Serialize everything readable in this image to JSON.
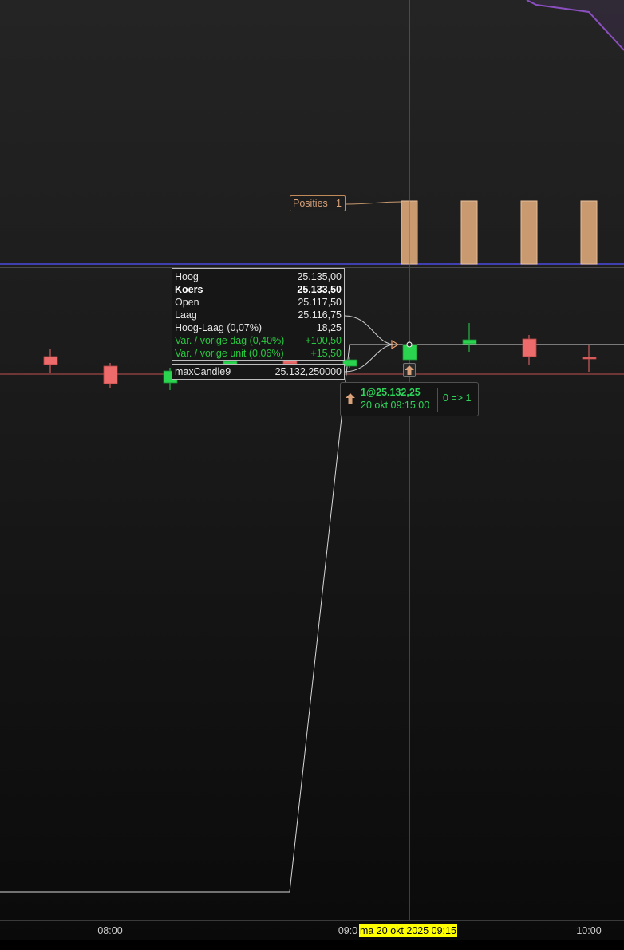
{
  "positions_panel": {
    "label": "Posities",
    "value": "1"
  },
  "tooltip": {
    "rows": [
      {
        "label": "Hoog",
        "value": "25.135,00",
        "style": "normal"
      },
      {
        "label": "Koers",
        "value": "25.133,50",
        "style": "bold"
      },
      {
        "label": "Open",
        "value": "25.117,50",
        "style": "normal"
      },
      {
        "label": "Laag",
        "value": "25.116,75",
        "style": "normal"
      },
      {
        "label": "Hoog-Laag (0,07%)",
        "value": "18,25",
        "style": "normal"
      },
      {
        "label": "Var. / vorige dag (0,40%)",
        "value": "+100,50",
        "style": "green"
      },
      {
        "label": "Var. / vorige unit (0,06%)",
        "value": "+15,50",
        "style": "green"
      }
    ]
  },
  "indicator": {
    "name": "maxCandle9",
    "value": "25.132,250000"
  },
  "trade": {
    "price": "1@25.132,25",
    "time": "20 okt 09:15:00",
    "position_change": "0 => 1",
    "icon": "up-arrow-icon"
  },
  "time_axis": {
    "labels": [
      "08:00",
      "09:0",
      "10:00"
    ],
    "cursor_label": "ma 20 okt 2025 09:15"
  },
  "colors": {
    "bull": "#2bd44f",
    "bear": "#ee6b6b",
    "position_bar": "#c99a70",
    "cursor_line": "#c0504d",
    "indicator_line": "#d8d8d8",
    "upper_line": "#8b4fc0",
    "zero_line": "#4a4ae0"
  },
  "chart_data": {
    "type": "candlestick",
    "candles": [
      {
        "time": "07:45",
        "direction": "bear"
      },
      {
        "time": "08:00",
        "direction": "bear"
      },
      {
        "time": "08:15",
        "direction": "bull"
      },
      {
        "time": "08:30",
        "direction": "bull"
      },
      {
        "time": "08:45",
        "direction": "bear"
      },
      {
        "time": "09:00",
        "direction": "bull"
      },
      {
        "time": "09:15",
        "open": 25117.5,
        "high": 25135.0,
        "low": 25116.75,
        "close": 25133.5,
        "direction": "bull"
      },
      {
        "time": "09:30",
        "direction": "bull"
      },
      {
        "time": "09:45",
        "direction": "bear"
      },
      {
        "time": "10:00",
        "direction": "bear"
      }
    ],
    "positions": [
      {
        "time": "09:15",
        "value": 1
      },
      {
        "time": "09:30",
        "value": 1
      },
      {
        "time": "09:45",
        "value": 1
      },
      {
        "time": "10:00",
        "value": 1
      }
    ],
    "indicator": {
      "name": "maxCandle9",
      "value_at_cursor": 25132.25
    }
  }
}
